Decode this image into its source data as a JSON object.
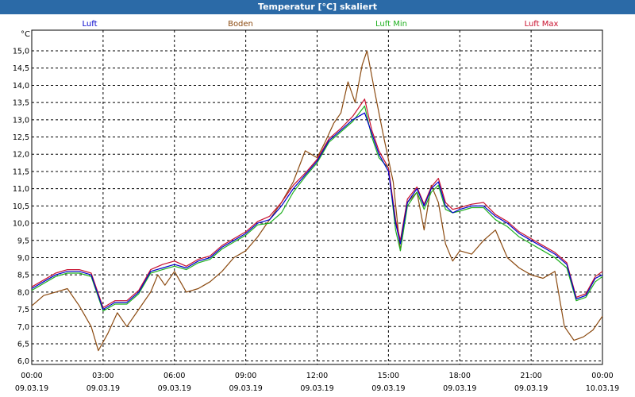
{
  "window": {
    "title": "Temperatur [°C] skaliert"
  },
  "chart_data": {
    "type": "line",
    "title": "Temperatur [°C] skaliert",
    "ylabel": "°C",
    "ylim": [
      5.9,
      15.6
    ],
    "yticks": [
      "6,0",
      "6,5",
      "7,0",
      "7,5",
      "8,0",
      "8,5",
      "9,0",
      "9,5",
      "10,0",
      "10,5",
      "11,0",
      "11,5",
      "12,0",
      "12,5",
      "13,0",
      "13,5",
      "14,0",
      "14,5",
      "15,0"
    ],
    "xlim": [
      0,
      24
    ],
    "xticks": [
      {
        "time": "00:00",
        "date": "09.03.19"
      },
      {
        "time": "03:00",
        "date": "09.03.19"
      },
      {
        "time": "06:00",
        "date": "09.03.19"
      },
      {
        "time": "09:00",
        "date": "09.03.19"
      },
      {
        "time": "12:00",
        "date": "09.03.19"
      },
      {
        "time": "15:00",
        "date": "09.03.19"
      },
      {
        "time": "18:00",
        "date": "09.03.19"
      },
      {
        "time": "21:00",
        "date": "09.03.19"
      },
      {
        "time": "00:00",
        "date": "10.03.19"
      }
    ],
    "grid": true,
    "legend": "top",
    "series": [
      {
        "name": "Luft",
        "color": "#0000cc",
        "points": [
          [
            0,
            8.1
          ],
          [
            0.5,
            8.3
          ],
          [
            1,
            8.5
          ],
          [
            1.5,
            8.6
          ],
          [
            2,
            8.6
          ],
          [
            2.5,
            8.5
          ],
          [
            3,
            7.5
          ],
          [
            3.5,
            7.7
          ],
          [
            4,
            7.7
          ],
          [
            4.5,
            8.0
          ],
          [
            5,
            8.6
          ],
          [
            5.5,
            8.7
          ],
          [
            6,
            8.8
          ],
          [
            6.5,
            8.7
          ],
          [
            7,
            8.9
          ],
          [
            7.5,
            9.0
          ],
          [
            8,
            9.3
          ],
          [
            8.5,
            9.5
          ],
          [
            9,
            9.7
          ],
          [
            9.5,
            10.0
          ],
          [
            10,
            10.1
          ],
          [
            10.5,
            10.5
          ],
          [
            11,
            11.0
          ],
          [
            11.5,
            11.4
          ],
          [
            12,
            11.8
          ],
          [
            12.5,
            12.4
          ],
          [
            13,
            12.7
          ],
          [
            13.5,
            13.0
          ],
          [
            14,
            13.2
          ],
          [
            14.3,
            12.6
          ],
          [
            14.6,
            12.0
          ],
          [
            15,
            11.5
          ],
          [
            15.3,
            10.0
          ],
          [
            15.5,
            9.4
          ],
          [
            15.8,
            10.6
          ],
          [
            16.2,
            11.0
          ],
          [
            16.5,
            10.5
          ],
          [
            16.8,
            11.0
          ],
          [
            17.1,
            11.2
          ],
          [
            17.4,
            10.5
          ],
          [
            17.7,
            10.3
          ],
          [
            18,
            10.4
          ],
          [
            18.5,
            10.5
          ],
          [
            19,
            10.5
          ],
          [
            19.5,
            10.2
          ],
          [
            20,
            10.0
          ],
          [
            20.5,
            9.7
          ],
          [
            21,
            9.5
          ],
          [
            21.5,
            9.3
          ],
          [
            22,
            9.1
          ],
          [
            22.5,
            8.8
          ],
          [
            22.9,
            7.8
          ],
          [
            23.3,
            7.9
          ],
          [
            23.7,
            8.4
          ],
          [
            24,
            8.5
          ]
        ]
      },
      {
        "name": "Boden",
        "color": "#8b4a10",
        "points": [
          [
            0,
            7.6
          ],
          [
            0.5,
            7.9
          ],
          [
            1,
            8.0
          ],
          [
            1.5,
            8.1
          ],
          [
            2,
            7.6
          ],
          [
            2.5,
            7.0
          ],
          [
            2.8,
            6.3
          ],
          [
            3.2,
            6.8
          ],
          [
            3.6,
            7.4
          ],
          [
            4,
            7.0
          ],
          [
            4.5,
            7.5
          ],
          [
            5,
            8.0
          ],
          [
            5.3,
            8.5
          ],
          [
            5.6,
            8.2
          ],
          [
            6,
            8.6
          ],
          [
            6.5,
            8.0
          ],
          [
            7,
            8.1
          ],
          [
            7.5,
            8.3
          ],
          [
            8,
            8.6
          ],
          [
            8.5,
            9.0
          ],
          [
            9,
            9.2
          ],
          [
            9.5,
            9.6
          ],
          [
            10,
            10.1
          ],
          [
            10.5,
            10.6
          ],
          [
            11,
            11.2
          ],
          [
            11.5,
            12.1
          ],
          [
            12,
            11.9
          ],
          [
            12.3,
            12.3
          ],
          [
            12.7,
            12.9
          ],
          [
            13,
            13.2
          ],
          [
            13.3,
            14.1
          ],
          [
            13.6,
            13.5
          ],
          [
            13.9,
            14.6
          ],
          [
            14.1,
            15.0
          ],
          [
            14.4,
            13.9
          ],
          [
            14.8,
            12.5
          ],
          [
            15.2,
            11.2
          ],
          [
            15.5,
            9.2
          ],
          [
            15.8,
            10.6
          ],
          [
            16.2,
            10.9
          ],
          [
            16.5,
            9.8
          ],
          [
            16.8,
            11.1
          ],
          [
            17.1,
            10.6
          ],
          [
            17.4,
            9.4
          ],
          [
            17.7,
            8.9
          ],
          [
            18,
            9.2
          ],
          [
            18.5,
            9.1
          ],
          [
            19,
            9.5
          ],
          [
            19.5,
            9.8
          ],
          [
            20,
            9.0
          ],
          [
            20.5,
            8.7
          ],
          [
            21,
            8.5
          ],
          [
            21.5,
            8.4
          ],
          [
            22,
            8.6
          ],
          [
            22.4,
            7.0
          ],
          [
            22.8,
            6.6
          ],
          [
            23.2,
            6.7
          ],
          [
            23.6,
            6.9
          ],
          [
            24,
            7.3
          ]
        ]
      },
      {
        "name": "Luft Min",
        "color": "#1fb01f",
        "points": [
          [
            0,
            8.05
          ],
          [
            0.5,
            8.25
          ],
          [
            1,
            8.45
          ],
          [
            1.5,
            8.55
          ],
          [
            2,
            8.55
          ],
          [
            2.5,
            8.45
          ],
          [
            3,
            7.45
          ],
          [
            3.5,
            7.65
          ],
          [
            4,
            7.65
          ],
          [
            4.5,
            7.95
          ],
          [
            5,
            8.55
          ],
          [
            5.5,
            8.65
          ],
          [
            6,
            8.75
          ],
          [
            6.5,
            8.65
          ],
          [
            7,
            8.85
          ],
          [
            7.5,
            8.95
          ],
          [
            8,
            9.25
          ],
          [
            8.5,
            9.45
          ],
          [
            9,
            9.65
          ],
          [
            9.5,
            9.95
          ],
          [
            10,
            10.0
          ],
          [
            10.5,
            10.3
          ],
          [
            11,
            10.9
          ],
          [
            11.5,
            11.35
          ],
          [
            12,
            11.75
          ],
          [
            12.5,
            12.35
          ],
          [
            13,
            12.65
          ],
          [
            13.5,
            12.95
          ],
          [
            14,
            13.4
          ],
          [
            14.3,
            12.5
          ],
          [
            14.6,
            11.9
          ],
          [
            15,
            11.6
          ],
          [
            15.3,
            9.8
          ],
          [
            15.5,
            9.2
          ],
          [
            15.8,
            10.5
          ],
          [
            16.2,
            10.9
          ],
          [
            16.5,
            10.4
          ],
          [
            16.8,
            10.9
          ],
          [
            17.1,
            11.1
          ],
          [
            17.4,
            10.4
          ],
          [
            17.7,
            10.3
          ],
          [
            18,
            10.35
          ],
          [
            18.5,
            10.45
          ],
          [
            19,
            10.45
          ],
          [
            19.5,
            10.1
          ],
          [
            20,
            9.9
          ],
          [
            20.5,
            9.6
          ],
          [
            21,
            9.4
          ],
          [
            21.5,
            9.2
          ],
          [
            22,
            9.0
          ],
          [
            22.5,
            8.7
          ],
          [
            22.9,
            7.75
          ],
          [
            23.3,
            7.85
          ],
          [
            23.7,
            8.3
          ],
          [
            24,
            8.45
          ]
        ]
      },
      {
        "name": "Luft Max",
        "color": "#c8102e",
        "points": [
          [
            0,
            8.15
          ],
          [
            0.5,
            8.35
          ],
          [
            1,
            8.55
          ],
          [
            1.5,
            8.65
          ],
          [
            2,
            8.65
          ],
          [
            2.5,
            8.55
          ],
          [
            3,
            7.55
          ],
          [
            3.5,
            7.75
          ],
          [
            4,
            7.75
          ],
          [
            4.5,
            8.05
          ],
          [
            5,
            8.65
          ],
          [
            5.5,
            8.8
          ],
          [
            6,
            8.9
          ],
          [
            6.5,
            8.75
          ],
          [
            7,
            8.95
          ],
          [
            7.5,
            9.05
          ],
          [
            8,
            9.35
          ],
          [
            8.5,
            9.55
          ],
          [
            9,
            9.75
          ],
          [
            9.5,
            10.05
          ],
          [
            10,
            10.2
          ],
          [
            10.5,
            10.6
          ],
          [
            11,
            11.1
          ],
          [
            11.5,
            11.45
          ],
          [
            12,
            11.85
          ],
          [
            12.5,
            12.45
          ],
          [
            13,
            12.75
          ],
          [
            13.5,
            13.1
          ],
          [
            14,
            13.6
          ],
          [
            14.3,
            12.7
          ],
          [
            14.6,
            12.1
          ],
          [
            15,
            11.6
          ],
          [
            15.3,
            10.1
          ],
          [
            15.5,
            9.5
          ],
          [
            15.8,
            10.7
          ],
          [
            16.2,
            11.05
          ],
          [
            16.5,
            10.55
          ],
          [
            16.8,
            11.05
          ],
          [
            17.1,
            11.3
          ],
          [
            17.4,
            10.6
          ],
          [
            17.7,
            10.4
          ],
          [
            18,
            10.45
          ],
          [
            18.5,
            10.55
          ],
          [
            19,
            10.6
          ],
          [
            19.5,
            10.25
          ],
          [
            20,
            10.05
          ],
          [
            20.5,
            9.75
          ],
          [
            21,
            9.55
          ],
          [
            21.5,
            9.35
          ],
          [
            22,
            9.15
          ],
          [
            22.5,
            8.85
          ],
          [
            22.9,
            7.85
          ],
          [
            23.3,
            7.95
          ],
          [
            23.7,
            8.45
          ],
          [
            24,
            8.6
          ]
        ]
      }
    ]
  }
}
